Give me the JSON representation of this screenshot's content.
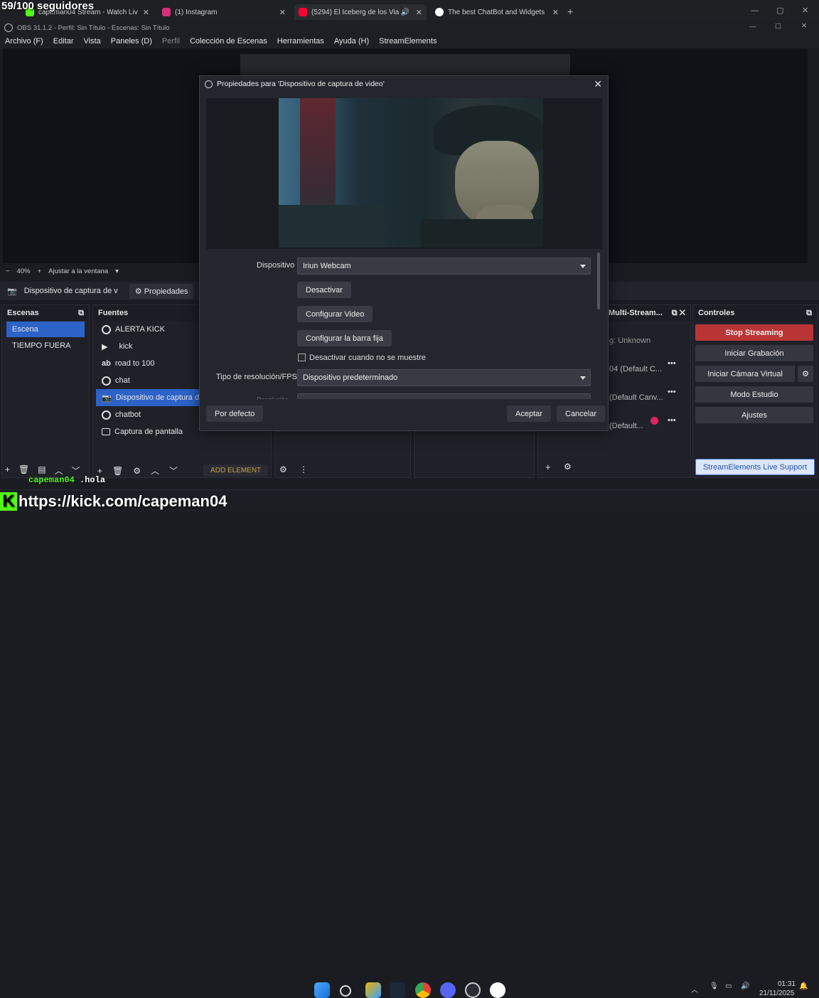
{
  "overlay": {
    "followers": "59/100 seguidores",
    "kick_url": "https://kick.com/capeman04",
    "chat_user": "capeman04",
    "chat_message": ".hola"
  },
  "browser": {
    "tabs": [
      {
        "label": "capeman04 Stream - Watch Liv",
        "favicon": "kick-icon",
        "color": "#53fc18"
      },
      {
        "label": "(1) Instagram",
        "favicon": "instagram-icon",
        "color": "#d6317b"
      },
      {
        "label": "(5294) El Iceberg de los Via",
        "favicon": "youtube-icon",
        "color": "#ff0033"
      },
      {
        "label": "The best ChatBot and Widgets",
        "favicon": "streamelements-icon",
        "color": "#ffffff"
      }
    ]
  },
  "obs": {
    "title": "OBS 31.1.2 - Perfil: Sin Título - Escenas: Sin Título",
    "menu": [
      "Archivo (F)",
      "Editar",
      "Vista",
      "Paneles (D)",
      "Perfil",
      "Colección de Escenas",
      "Herramientas",
      "Ayuda (H)",
      "StreamElements"
    ],
    "zoom": {
      "minus": "−",
      "value": "40%",
      "plus": "+",
      "fit": "Ajustar a la ventana"
    },
    "source_bar": {
      "source": "Dispositivo de captura de v",
      "properties": "Propiedades"
    },
    "scenes": {
      "title": "Escenas",
      "items": [
        "Escena",
        "TIEMPO FUERA"
      ],
      "selected": 0
    },
    "sources": {
      "title": "Fuentes",
      "items": [
        {
          "label": "ALERTA KICK",
          "icon": "browser-icon"
        },
        {
          "label": "kick",
          "icon": "folder-expand-icon"
        },
        {
          "label": "road to 100",
          "icon": "text-icon"
        },
        {
          "label": "chat",
          "icon": "browser-icon"
        },
        {
          "label": "Dispositivo de captura de",
          "icon": "camera-icon"
        },
        {
          "label": "chatbot",
          "icon": "browser-icon"
        },
        {
          "label": "Captura de pantalla",
          "icon": "monitor-icon"
        }
      ],
      "selected": 4,
      "add_element": "ADD ELEMENT"
    },
    "multistream": {
      "title": "Multi-Stream...",
      "rows": [
        "g: Unknown",
        "04 (Default C...",
        "(Default Canv...",
        "(Default..."
      ]
    },
    "controls": {
      "title": "Controles",
      "stop_streaming": "Stop Streaming",
      "start_recording": "Iniciar Grabación",
      "virtual_camera": "Iniciar Cámara Virtual",
      "studio_mode": "Modo Estudio",
      "settings": "Ajustes",
      "support": "StreamElements Live Support"
    }
  },
  "dialog": {
    "title": "Propiedades para 'Dispositivo de captura de video'",
    "device_label": "Dispositivo",
    "device_value": "Iriun Webcam",
    "deactivate": "Desactivar",
    "configure_video": "Configurar Video",
    "configure_bar": "Configurar la barra fija",
    "checkbox_label": "Desactivar cuando no se muestre",
    "resolution_label": "Tipo de resolución/FPS",
    "resolution_value": "Dispositivo predeterminado",
    "partial_label": "Resolución",
    "defaults": "Por defecto",
    "accept": "Aceptar",
    "cancel": "Cancelar"
  },
  "taskbar": {
    "time": "01:31",
    "date": "21/11/2025"
  },
  "colors": {
    "selection": "#2d63c9",
    "stop_streaming": "#b93535",
    "support_border": "#4a7bd8"
  }
}
